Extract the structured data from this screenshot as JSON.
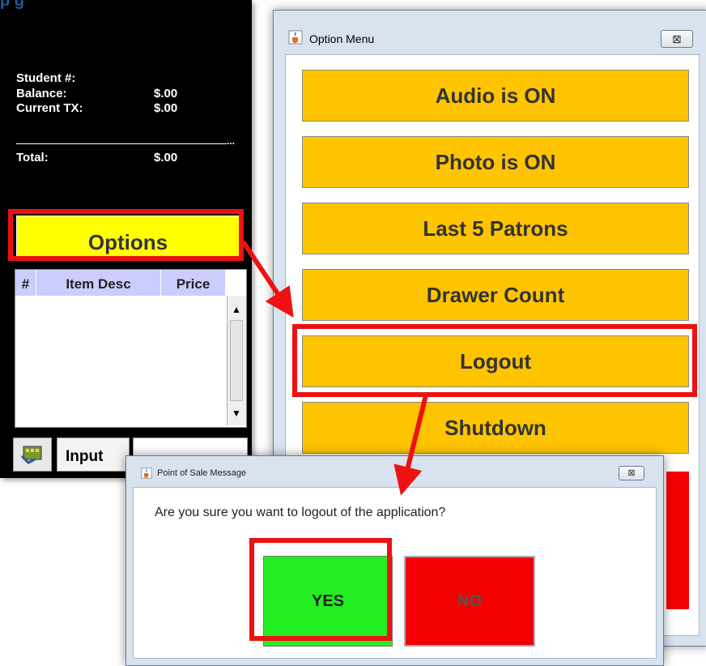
{
  "page": {
    "heading_partial": "p   g"
  },
  "pos": {
    "student_label": "Student #:",
    "balance_label": "Balance:",
    "balance_value": "$.00",
    "current_tx_label": "Current TX:",
    "current_tx_value": "$.00",
    "rule_dots": "...",
    "total_label": "Total:",
    "total_value": "$.00",
    "options_label": "Options",
    "table": {
      "columns": [
        "#",
        "Item Desc",
        "Price"
      ],
      "rows": []
    },
    "input_label": "Input",
    "input_value": ""
  },
  "option_menu": {
    "title": "Option Menu",
    "close_glyph": "⊠",
    "buttons": [
      {
        "label": "Audio is ON"
      },
      {
        "label": "Photo is ON"
      },
      {
        "label": "Last 5 Patrons"
      },
      {
        "label": "Drawer Count"
      },
      {
        "label": "Logout"
      },
      {
        "label": "Shutdown"
      }
    ]
  },
  "dialog": {
    "title": "Point of Sale Message",
    "close_glyph": "⊠",
    "message": "Are you sure you want to logout of the application?",
    "yes_label": "YES",
    "no_label": "NO"
  },
  "colors": {
    "highlight": "#ee1111",
    "menu_button": "#ffc400",
    "options_button": "#ffff00",
    "yes_button": "#22ee22",
    "no_button": "#f40000",
    "table_header": "#ccccff"
  },
  "icons": {
    "java_app_icon": "java-cup-icon",
    "window_close": "close-icon",
    "input_toggle": "keyboard-hand-icon"
  }
}
